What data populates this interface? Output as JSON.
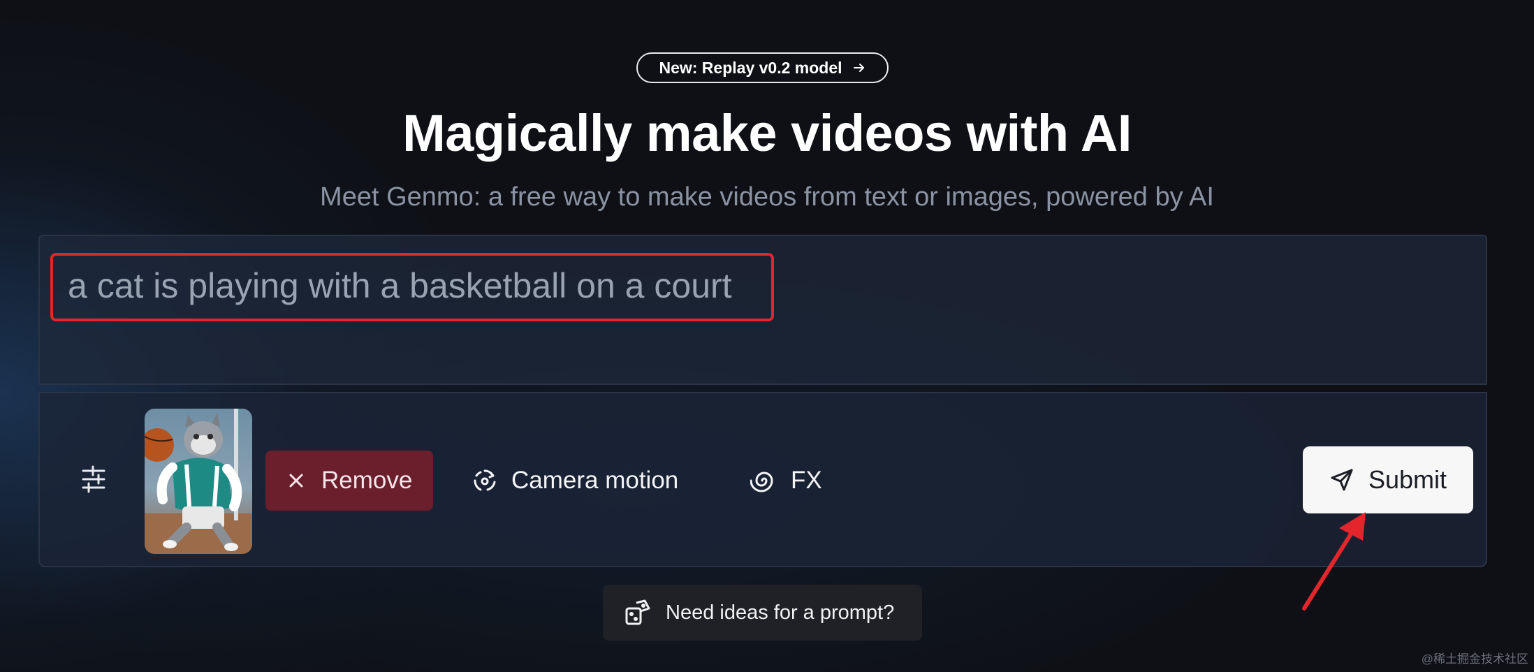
{
  "banner": {
    "label": "New: Replay v0.2 model"
  },
  "hero": {
    "title": "Magically make videos with AI",
    "subtitle": "Meet Genmo: a free way to make videos from text or images, powered by AI"
  },
  "prompt": {
    "value": "a cat is playing with a basketball on a court"
  },
  "toolbar": {
    "remove_label": "Remove",
    "camera_label": "Camera motion",
    "fx_label": "FX",
    "submit_label": "Submit"
  },
  "ideas": {
    "label": "Need ideas for a prompt?"
  },
  "watermark": "@稀土掘金技术社区",
  "colors": {
    "highlight_border": "#e3262b",
    "remove_bg": "#6b1e2c",
    "submit_bg": "#f7f7f8",
    "page_bg": "#0e1015"
  },
  "icons": {
    "banner": "arrow-right-icon",
    "settings": "sliders-icon",
    "remove": "close-icon",
    "camera": "camera-motion-icon",
    "fx": "spiral-icon",
    "submit": "send-icon",
    "ideas": "dice-icon"
  }
}
